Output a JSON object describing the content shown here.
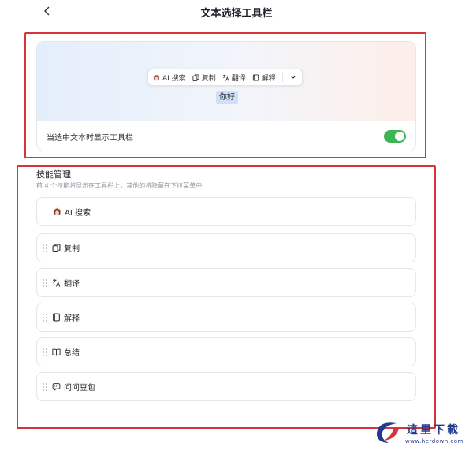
{
  "header": {
    "title": "文本选择工具栏"
  },
  "preview": {
    "toolbar_items": [
      {
        "label": "AI 搜索",
        "icon": "ai-avatar-icon"
      },
      {
        "label": "复制",
        "icon": "copy-icon"
      },
      {
        "label": "翻译",
        "icon": "translate-icon"
      },
      {
        "label": "解释",
        "icon": "book-icon"
      }
    ],
    "more_icon": "chevron-down-icon",
    "selected_text": "你好"
  },
  "toggle": {
    "label": "当选中文本时显示工具栏",
    "enabled": true,
    "color": "#3db552"
  },
  "skills": {
    "title": "技能管理",
    "description": "前 4 个技能将显示在工具栏上，其他的将隐藏在下拉菜单中",
    "items": [
      {
        "label": "AI 搜索",
        "icon": "ai-avatar-icon"
      },
      {
        "label": "复制",
        "icon": "copy-icon"
      },
      {
        "label": "翻译",
        "icon": "translate-icon"
      },
      {
        "label": "解释",
        "icon": "book-icon"
      },
      {
        "label": "总结",
        "icon": "open-book-icon"
      },
      {
        "label": "问问豆包",
        "icon": "chat-bubble-icon"
      }
    ]
  },
  "watermark": {
    "title": "這里下載",
    "url": "www.herdown.com"
  },
  "colors": {
    "highlight": "#d9333a",
    "accent": "#3db552",
    "selection": "#cfe0fb"
  }
}
